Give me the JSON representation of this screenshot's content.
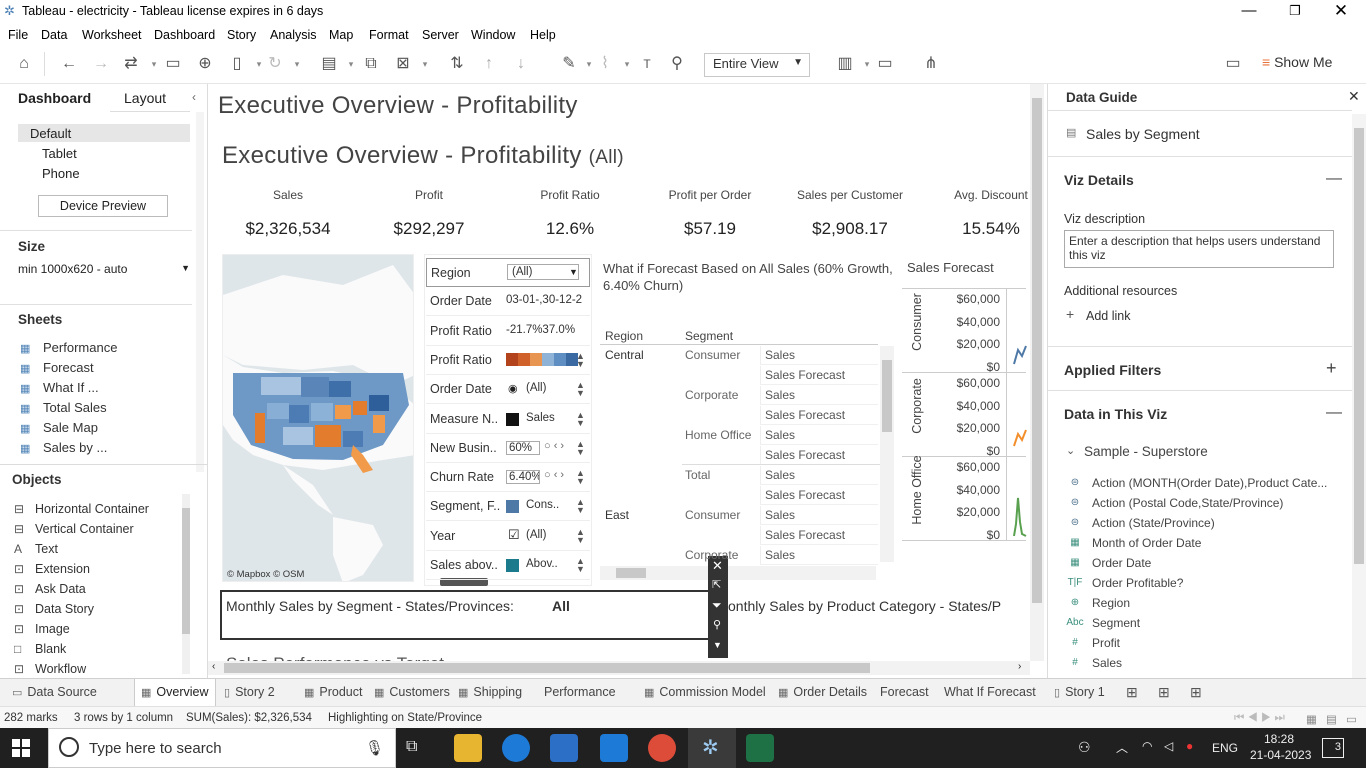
{
  "window": {
    "title": "Tableau - electricity - Tableau license expires in 6 days"
  },
  "menu": [
    "File",
    "Data",
    "Worksheet",
    "Dashboard",
    "Story",
    "Analysis",
    "Map",
    "Format",
    "Server",
    "Window",
    "Help"
  ],
  "toolbar": {
    "view_select": "Entire View",
    "show_me": "Show Me"
  },
  "left_panel": {
    "tabs": [
      "Dashboard",
      "Layout"
    ],
    "devices": [
      "Default",
      "Tablet",
      "Phone"
    ],
    "device_preview": "Device Preview",
    "size_label": "Size",
    "size_value": "min 1000x620 - auto",
    "sheets_label": "Sheets",
    "sheets": [
      "Performance",
      "Forecast",
      "What If ...",
      "Total Sales",
      "Sale Map",
      "Sales by ..."
    ],
    "objects_label": "Objects",
    "objects": [
      "Horizontal Container",
      "Vertical Container",
      "Text",
      "Extension",
      "Ask Data",
      "Data Story",
      "Image",
      "Blank",
      "Workflow"
    ]
  },
  "dashboard": {
    "page_title": "Executive Overview - Profitability",
    "inner_title": "Executive Overview - Profitability",
    "inner_title_suffix": "(All)",
    "kpis": [
      {
        "label": "Sales",
        "value": "$2,326,534"
      },
      {
        "label": "Profit",
        "value": "$292,297"
      },
      {
        "label": "Profit Ratio",
        "value": "12.6%"
      },
      {
        "label": "Profit per Order",
        "value": "$57.19"
      },
      {
        "label": "Sales per Customer",
        "value": "$2,908.17"
      },
      {
        "label": "Avg. Discount",
        "value": "15.54%"
      }
    ],
    "map_attrib": "© Mapbox © OSM",
    "filters": [
      {
        "label": "Region",
        "value": "(All)"
      },
      {
        "label": "Order Date",
        "value": "03-01-,30-12-2"
      },
      {
        "label": "Profit Ratio",
        "value": "-21.7%37.0%"
      },
      {
        "label": "Profit Ratio",
        "value": ""
      },
      {
        "label": "Order Date",
        "value": "(All)"
      },
      {
        "label": "Measure N..",
        "value": "Sales"
      },
      {
        "label": "New Busin..",
        "value": "60%"
      },
      {
        "label": "Churn Rate",
        "value": "6.40%"
      },
      {
        "label": "Segment, F..",
        "value": "Cons.."
      },
      {
        "label": "Year",
        "value": "(All)"
      },
      {
        "label": "Sales abov..",
        "value": "Abov.."
      }
    ],
    "whatif_title": "What if Forecast Based on All Sales (60% Growth, 6.40% Churn)",
    "table_headers": [
      "Region",
      "Segment"
    ],
    "table_rows": [
      {
        "region": "Central",
        "segment": "Consumer",
        "measures": [
          "Sales",
          "Sales Forecast"
        ]
      },
      {
        "region": "",
        "segment": "Corporate",
        "measures": [
          "Sales",
          "Sales Forecast"
        ]
      },
      {
        "region": "",
        "segment": "Home Office",
        "measures": [
          "Sales",
          "Sales Forecast"
        ]
      },
      {
        "region": "",
        "segment": "Total",
        "measures": [
          "Sales",
          "Sales Forecast"
        ]
      },
      {
        "region": "East",
        "segment": "Consumer",
        "measures": [
          "Sales",
          "Sales Forecast"
        ]
      },
      {
        "region": "",
        "segment": "Corporate",
        "measures": [
          "Sales"
        ]
      }
    ],
    "forecast_title": "Sales Forecast",
    "forecast_panels": [
      {
        "segment": "Consumer",
        "ticks": [
          "$60,000",
          "$40,000",
          "$20,000",
          "$0"
        ]
      },
      {
        "segment": "Corporate",
        "ticks": [
          "$60,000",
          "$40,000",
          "$20,000",
          "$0"
        ]
      },
      {
        "segment": "Home Office",
        "ticks": [
          "$60,000",
          "$40,000",
          "$20,000",
          "$0"
        ]
      }
    ],
    "monthly_segment_label": "Monthly Sales by Segment - States/Provinces:",
    "monthly_segment_value": "All",
    "monthly_category_label": "onthly Sales by Product Category - States/P",
    "bottom_partial": "Sales Performance vs Target"
  },
  "right_panel": {
    "title": "Data Guide",
    "viz_name": "Sales by Segment",
    "viz_details": "Viz Details",
    "viz_description_label": "Viz description",
    "viz_description_placeholder": "Enter a description that helps users understand this viz",
    "additional_resources": "Additional resources",
    "add_link": "Add link",
    "applied_filters": "Applied Filters",
    "data_in_viz": "Data in This Viz",
    "datasource": "Sample - Superstore",
    "fields": [
      {
        "icon": "action",
        "name": "Action (MONTH(Order Date),Product Cate..."
      },
      {
        "icon": "action",
        "name": "Action (Postal Code,State/Province)"
      },
      {
        "icon": "action",
        "name": "Action (State/Province)"
      },
      {
        "icon": "date",
        "name": "Month of Order Date"
      },
      {
        "icon": "date",
        "name": "Order Date"
      },
      {
        "icon": "tf",
        "name": "Order Profitable?"
      },
      {
        "icon": "globe",
        "name": "Region"
      },
      {
        "icon": "abc",
        "name": "Segment"
      },
      {
        "icon": "hash",
        "name": "Profit"
      },
      {
        "icon": "hash",
        "name": "Sales"
      }
    ]
  },
  "sheet_tabs": [
    "Data Source",
    "Overview",
    "Story 2",
    "Product",
    "Customers",
    "Shipping",
    "Performance",
    "Commission Model",
    "Order Details",
    "Forecast",
    "What If Forecast",
    "Story 1"
  ],
  "status": {
    "marks": "282 marks",
    "dims": "3 rows by 1 column",
    "sum": "SUM(Sales): $2,326,534",
    "highlight": "Highlighting on State/Province"
  },
  "taskbar": {
    "search": "Type here to search",
    "lang": "ENG",
    "time": "18:28",
    "date": "21-04-2023",
    "notif": "3"
  }
}
